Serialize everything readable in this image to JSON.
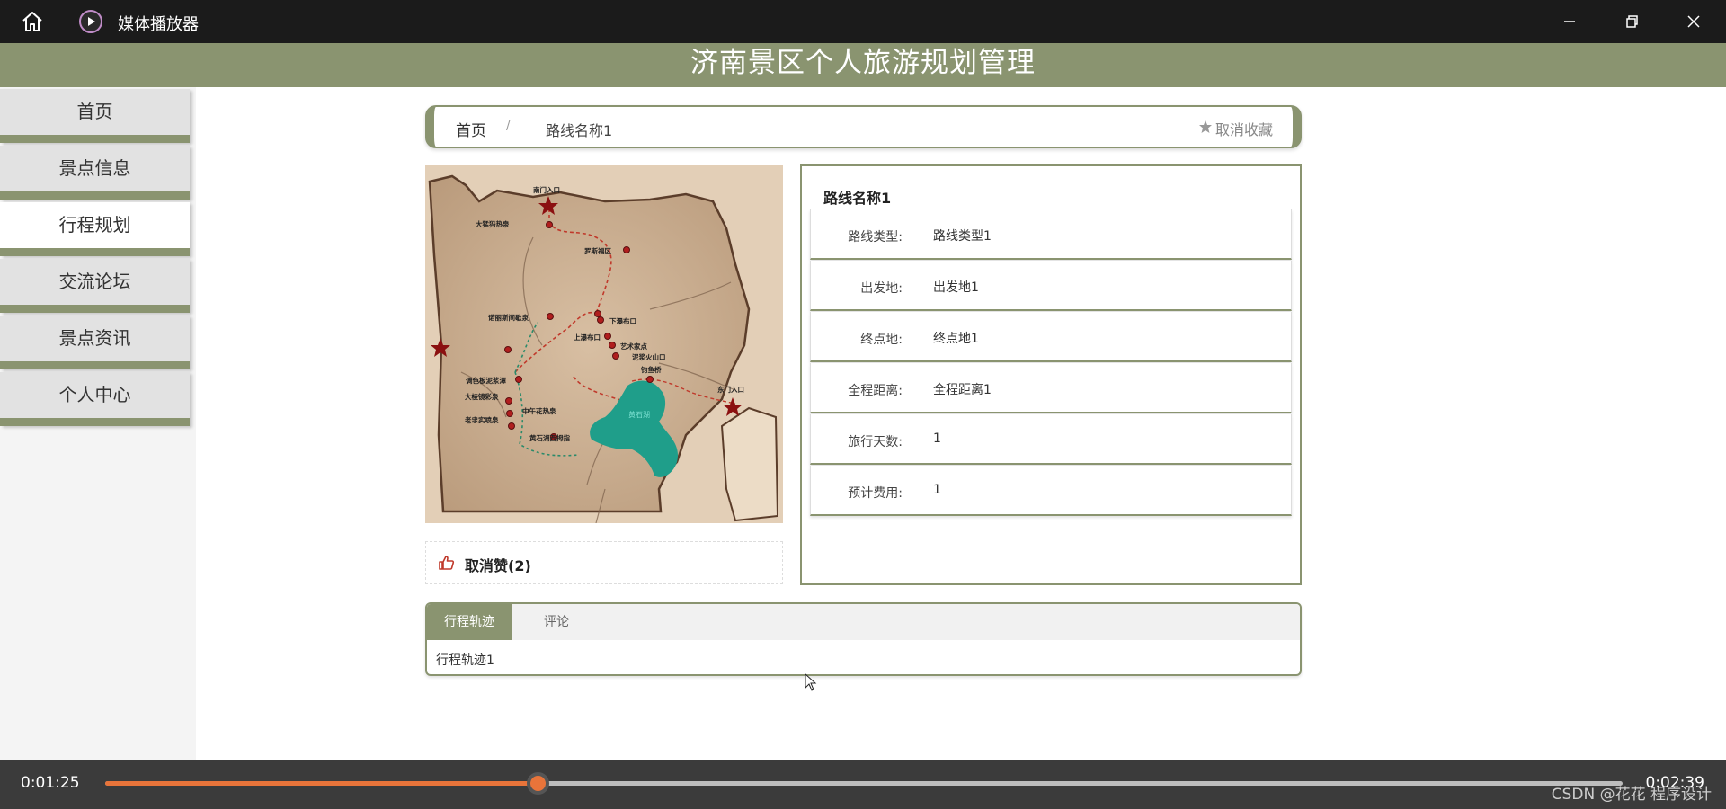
{
  "window": {
    "app_name": "媒体播放器"
  },
  "site": {
    "title": "济南景区个人旅游规划管理"
  },
  "sidebar": {
    "items": [
      {
        "label": "首页",
        "active": false
      },
      {
        "label": "景点信息",
        "active": false
      },
      {
        "label": "行程规划",
        "active": true
      },
      {
        "label": "交流论坛",
        "active": false
      },
      {
        "label": "景点资讯",
        "active": false
      },
      {
        "label": "个人中心",
        "active": false
      }
    ]
  },
  "breadcrumb": {
    "home": "首页",
    "separator": "/",
    "current": "路线名称1",
    "favorite_label": "取消收藏"
  },
  "map": {
    "labels": {
      "south_gate": "南门入口",
      "east_gate": "东门入口",
      "lake": "黄石湖",
      "spot_1": "大猛犸热泉",
      "spot_2": "罗斯福区",
      "spot_3": "诺丽斯间歇泉",
      "spot_4": "上瀑布口",
      "spot_5": "下瀑布口",
      "spot_6": "艺术家点",
      "spot_7": "泥浆火山口",
      "spot_8": "钓鱼桥",
      "spot_9": "调色板泥浆潭",
      "spot_10": "大棱镜彩泉",
      "spot_11": "中午花热泉",
      "spot_12": "老忠实喷泉",
      "spot_13": "黄石湖西拇指"
    }
  },
  "like": {
    "label": "取消赞(2)"
  },
  "info": {
    "title": "路线名称1",
    "rows": [
      {
        "label": "路线类型:",
        "value": "路线类型1"
      },
      {
        "label": "出发地:",
        "value": "出发地1"
      },
      {
        "label": "终点地:",
        "value": "终点地1"
      },
      {
        "label": "全程距离:",
        "value": "全程距离1"
      },
      {
        "label": "旅行天数:",
        "value": "1"
      },
      {
        "label": "预计费用:",
        "value": "1"
      }
    ]
  },
  "tabs": {
    "items": [
      {
        "label": "行程轨迹",
        "active": true
      },
      {
        "label": "评论",
        "active": false
      }
    ],
    "content": "行程轨迹1"
  },
  "player": {
    "current_time": "0:01:25",
    "total_time": "0:02:39",
    "progress": 0.285
  },
  "watermark": "CSDN @花花 程序设计",
  "colors": {
    "accent": "#8a9470",
    "seek": "#e8743a",
    "titlebar": "#1b1b1b"
  }
}
